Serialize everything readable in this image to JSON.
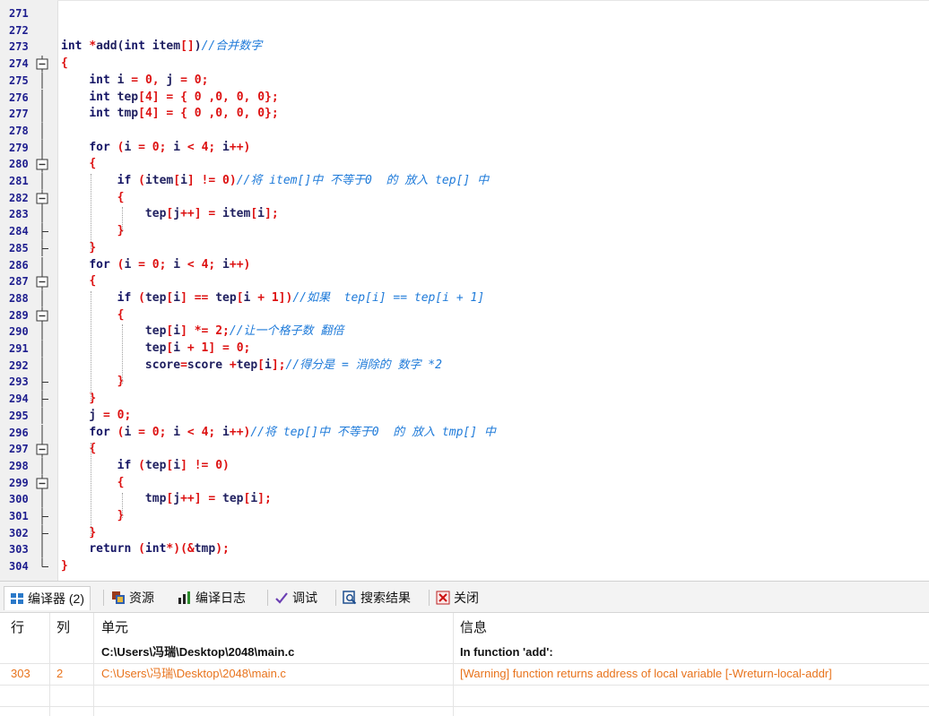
{
  "editor": {
    "lines": [
      {
        "n": "271",
        "fold": "none",
        "segs": []
      },
      {
        "n": "272",
        "fold": "none",
        "segs": []
      },
      {
        "n": "273",
        "fold": "none",
        "segs": [
          [
            "kw",
            "int "
          ],
          [
            "op",
            "*"
          ],
          [
            "id",
            "add("
          ],
          [
            "kw",
            "int "
          ],
          [
            "id",
            "item"
          ],
          [
            "op",
            "[]"
          ],
          [
            "id",
            ")"
          ],
          [
            "cmt",
            "//合并数字"
          ]
        ]
      },
      {
        "n": "274",
        "fold": "box-open",
        "segs": [
          [
            "op",
            "{"
          ]
        ]
      },
      {
        "n": "275",
        "fold": "bar",
        "segs": [
          [
            "id",
            "    "
          ],
          [
            "kw",
            "int "
          ],
          [
            "id",
            "i "
          ],
          [
            "op",
            "= "
          ],
          [
            "num",
            "0"
          ],
          [
            "op",
            ", "
          ],
          [
            "id",
            "j "
          ],
          [
            "op",
            "= "
          ],
          [
            "num",
            "0"
          ],
          [
            "op",
            ";"
          ]
        ]
      },
      {
        "n": "276",
        "fold": "bar",
        "segs": [
          [
            "id",
            "    "
          ],
          [
            "kw",
            "int "
          ],
          [
            "id",
            "tep"
          ],
          [
            "op",
            "["
          ],
          [
            "num",
            "4"
          ],
          [
            "op",
            "] = { "
          ],
          [
            "num",
            "0 "
          ],
          [
            "op",
            ","
          ],
          [
            "num",
            "0"
          ],
          [
            "op",
            ", "
          ],
          [
            "num",
            "0"
          ],
          [
            "op",
            ", "
          ],
          [
            "num",
            "0"
          ],
          [
            "op",
            "};"
          ]
        ]
      },
      {
        "n": "277",
        "fold": "bar",
        "segs": [
          [
            "id",
            "    "
          ],
          [
            "kw",
            "int "
          ],
          [
            "id",
            "tmp"
          ],
          [
            "op",
            "["
          ],
          [
            "num",
            "4"
          ],
          [
            "op",
            "] = { "
          ],
          [
            "num",
            "0 "
          ],
          [
            "op",
            ","
          ],
          [
            "num",
            "0"
          ],
          [
            "op",
            ", "
          ],
          [
            "num",
            "0"
          ],
          [
            "op",
            ", "
          ],
          [
            "num",
            "0"
          ],
          [
            "op",
            "};"
          ]
        ]
      },
      {
        "n": "278",
        "fold": "bar",
        "segs": []
      },
      {
        "n": "279",
        "fold": "bar",
        "segs": [
          [
            "id",
            "    "
          ],
          [
            "kw",
            "for "
          ],
          [
            "op",
            "("
          ],
          [
            "id",
            "i "
          ],
          [
            "op",
            "= "
          ],
          [
            "num",
            "0"
          ],
          [
            "op",
            "; "
          ],
          [
            "id",
            "i "
          ],
          [
            "op",
            "< "
          ],
          [
            "num",
            "4"
          ],
          [
            "op",
            "; "
          ],
          [
            "id",
            "i"
          ],
          [
            "op",
            "++)"
          ]
        ]
      },
      {
        "n": "280",
        "fold": "box-open",
        "segs": [
          [
            "id",
            "    "
          ],
          [
            "op",
            "{"
          ]
        ]
      },
      {
        "n": "281",
        "fold": "bar",
        "segs": [
          [
            "id",
            "        "
          ],
          [
            "kw",
            "if "
          ],
          [
            "op",
            "("
          ],
          [
            "id",
            "item"
          ],
          [
            "op",
            "["
          ],
          [
            "id",
            "i"
          ],
          [
            "op",
            "] != "
          ],
          [
            "num",
            "0"
          ],
          [
            "op",
            ")"
          ],
          [
            "cmt",
            "//将 item[]中 不等于0  的 放入 tep[] 中"
          ]
        ]
      },
      {
        "n": "282",
        "fold": "box-open",
        "segs": [
          [
            "id",
            "        "
          ],
          [
            "op",
            "{"
          ]
        ]
      },
      {
        "n": "283",
        "fold": "bar",
        "segs": [
          [
            "id",
            "            tep"
          ],
          [
            "op",
            "["
          ],
          [
            "id",
            "j"
          ],
          [
            "op",
            "++] = "
          ],
          [
            "id",
            "item"
          ],
          [
            "op",
            "["
          ],
          [
            "id",
            "i"
          ],
          [
            "op",
            "];"
          ]
        ]
      },
      {
        "n": "284",
        "fold": "end",
        "segs": [
          [
            "id",
            "        "
          ],
          [
            "op",
            "}"
          ]
        ]
      },
      {
        "n": "285",
        "fold": "end",
        "segs": [
          [
            "id",
            "    "
          ],
          [
            "op",
            "}"
          ]
        ]
      },
      {
        "n": "286",
        "fold": "bar",
        "segs": [
          [
            "id",
            "    "
          ],
          [
            "kw",
            "for "
          ],
          [
            "op",
            "("
          ],
          [
            "id",
            "i "
          ],
          [
            "op",
            "= "
          ],
          [
            "num",
            "0"
          ],
          [
            "op",
            "; "
          ],
          [
            "id",
            "i "
          ],
          [
            "op",
            "< "
          ],
          [
            "num",
            "4"
          ],
          [
            "op",
            "; "
          ],
          [
            "id",
            "i"
          ],
          [
            "op",
            "++)"
          ]
        ]
      },
      {
        "n": "287",
        "fold": "box-open",
        "segs": [
          [
            "id",
            "    "
          ],
          [
            "op",
            "{"
          ]
        ]
      },
      {
        "n": "288",
        "fold": "bar",
        "segs": [
          [
            "id",
            "        "
          ],
          [
            "kw",
            "if "
          ],
          [
            "op",
            "("
          ],
          [
            "id",
            "tep"
          ],
          [
            "op",
            "["
          ],
          [
            "id",
            "i"
          ],
          [
            "op",
            "] == "
          ],
          [
            "id",
            "tep"
          ],
          [
            "op",
            "["
          ],
          [
            "id",
            "i "
          ],
          [
            "op",
            "+ "
          ],
          [
            "num",
            "1"
          ],
          [
            "op",
            "])"
          ],
          [
            "cmt",
            "//如果  tep[i] == tep[i + 1]"
          ]
        ]
      },
      {
        "n": "289",
        "fold": "box-open",
        "segs": [
          [
            "id",
            "        "
          ],
          [
            "op",
            "{"
          ]
        ]
      },
      {
        "n": "290",
        "fold": "bar",
        "segs": [
          [
            "id",
            "            tep"
          ],
          [
            "op",
            "["
          ],
          [
            "id",
            "i"
          ],
          [
            "op",
            "] *= "
          ],
          [
            "num",
            "2"
          ],
          [
            "op",
            ";"
          ],
          [
            "cmt",
            "//让一个格子数 翻倍"
          ]
        ]
      },
      {
        "n": "291",
        "fold": "bar",
        "segs": [
          [
            "id",
            "            tep"
          ],
          [
            "op",
            "["
          ],
          [
            "id",
            "i "
          ],
          [
            "op",
            "+ "
          ],
          [
            "num",
            "1"
          ],
          [
            "op",
            "] = "
          ],
          [
            "num",
            "0"
          ],
          [
            "op",
            ";"
          ]
        ]
      },
      {
        "n": "292",
        "fold": "bar",
        "segs": [
          [
            "id",
            "            score"
          ],
          [
            "op",
            "="
          ],
          [
            "id",
            "score "
          ],
          [
            "op",
            "+"
          ],
          [
            "id",
            "tep"
          ],
          [
            "op",
            "["
          ],
          [
            "id",
            "i"
          ],
          [
            "op",
            "];"
          ],
          [
            "cmt",
            "//得分是 = 消除的 数字 *2"
          ]
        ]
      },
      {
        "n": "293",
        "fold": "end",
        "segs": [
          [
            "id",
            "        "
          ],
          [
            "op",
            "}"
          ]
        ]
      },
      {
        "n": "294",
        "fold": "end",
        "segs": [
          [
            "id",
            "    "
          ],
          [
            "op",
            "}"
          ]
        ]
      },
      {
        "n": "295",
        "fold": "bar",
        "segs": [
          [
            "id",
            "    j "
          ],
          [
            "op",
            "= "
          ],
          [
            "num",
            "0"
          ],
          [
            "op",
            ";"
          ]
        ]
      },
      {
        "n": "296",
        "fold": "bar",
        "segs": [
          [
            "id",
            "    "
          ],
          [
            "kw",
            "for "
          ],
          [
            "op",
            "("
          ],
          [
            "id",
            "i "
          ],
          [
            "op",
            "= "
          ],
          [
            "num",
            "0"
          ],
          [
            "op",
            "; "
          ],
          [
            "id",
            "i "
          ],
          [
            "op",
            "< "
          ],
          [
            "num",
            "4"
          ],
          [
            "op",
            "; "
          ],
          [
            "id",
            "i"
          ],
          [
            "op",
            "++)"
          ],
          [
            "cmt",
            "//将 tep[]中 不等于0  的 放入 tmp[] 中"
          ]
        ]
      },
      {
        "n": "297",
        "fold": "box-open",
        "segs": [
          [
            "id",
            "    "
          ],
          [
            "op",
            "{"
          ]
        ]
      },
      {
        "n": "298",
        "fold": "bar",
        "segs": [
          [
            "id",
            "        "
          ],
          [
            "kw",
            "if "
          ],
          [
            "op",
            "("
          ],
          [
            "id",
            "tep"
          ],
          [
            "op",
            "["
          ],
          [
            "id",
            "i"
          ],
          [
            "op",
            "] != "
          ],
          [
            "num",
            "0"
          ],
          [
            "op",
            ")"
          ]
        ]
      },
      {
        "n": "299",
        "fold": "box-open",
        "segs": [
          [
            "id",
            "        "
          ],
          [
            "op",
            "{"
          ]
        ]
      },
      {
        "n": "300",
        "fold": "bar",
        "segs": [
          [
            "id",
            "            tmp"
          ],
          [
            "op",
            "["
          ],
          [
            "id",
            "j"
          ],
          [
            "op",
            "++] = "
          ],
          [
            "id",
            "tep"
          ],
          [
            "op",
            "["
          ],
          [
            "id",
            "i"
          ],
          [
            "op",
            "];"
          ]
        ]
      },
      {
        "n": "301",
        "fold": "end",
        "segs": [
          [
            "id",
            "        "
          ],
          [
            "op",
            "}"
          ]
        ]
      },
      {
        "n": "302",
        "fold": "end",
        "segs": [
          [
            "id",
            "    "
          ],
          [
            "op",
            "}"
          ]
        ]
      },
      {
        "n": "303",
        "fold": "bar",
        "segs": [
          [
            "id",
            "    "
          ],
          [
            "kw",
            "return "
          ],
          [
            "op",
            "("
          ],
          [
            "kw",
            "int"
          ],
          [
            "op",
            "*)(&"
          ],
          [
            "id",
            "tmp"
          ],
          [
            "op",
            ");"
          ]
        ]
      },
      {
        "n": "304",
        "fold": "last",
        "segs": [
          [
            "op",
            "}"
          ]
        ]
      }
    ]
  },
  "panel": {
    "tabs": [
      {
        "label": "编译器 (2)",
        "icon": "compiler-grid-icon",
        "active": true
      },
      {
        "label": "资源",
        "icon": "resources-icon",
        "active": false
      },
      {
        "label": "编译日志",
        "icon": "compile-log-chart-icon",
        "active": false
      },
      {
        "label": "调试",
        "icon": "debug-check-icon",
        "active": false
      },
      {
        "label": "搜索结果",
        "icon": "search-results-icon",
        "active": false
      },
      {
        "label": "关闭",
        "icon": "close-icon",
        "active": false
      }
    ],
    "headers": {
      "row": "行",
      "col": "列",
      "unit": "单元",
      "info": "信息"
    },
    "rows": [
      {
        "row": "",
        "col": "",
        "unit": "C:\\Users\\冯瑞\\Desktop\\2048\\main.c",
        "info": "In function 'add':",
        "style": "bold"
      },
      {
        "row": "303",
        "col": "2",
        "unit": "C:\\Users\\冯瑞\\Desktop\\2048\\main.c",
        "info": "[Warning] function returns address of local variable [-Wreturn-local-addr]",
        "style": "warn"
      }
    ]
  },
  "colors": {
    "keyword": "#151565",
    "operator": "#dd1111",
    "comment": "#1e7ad9",
    "warning": "#e8731c"
  }
}
